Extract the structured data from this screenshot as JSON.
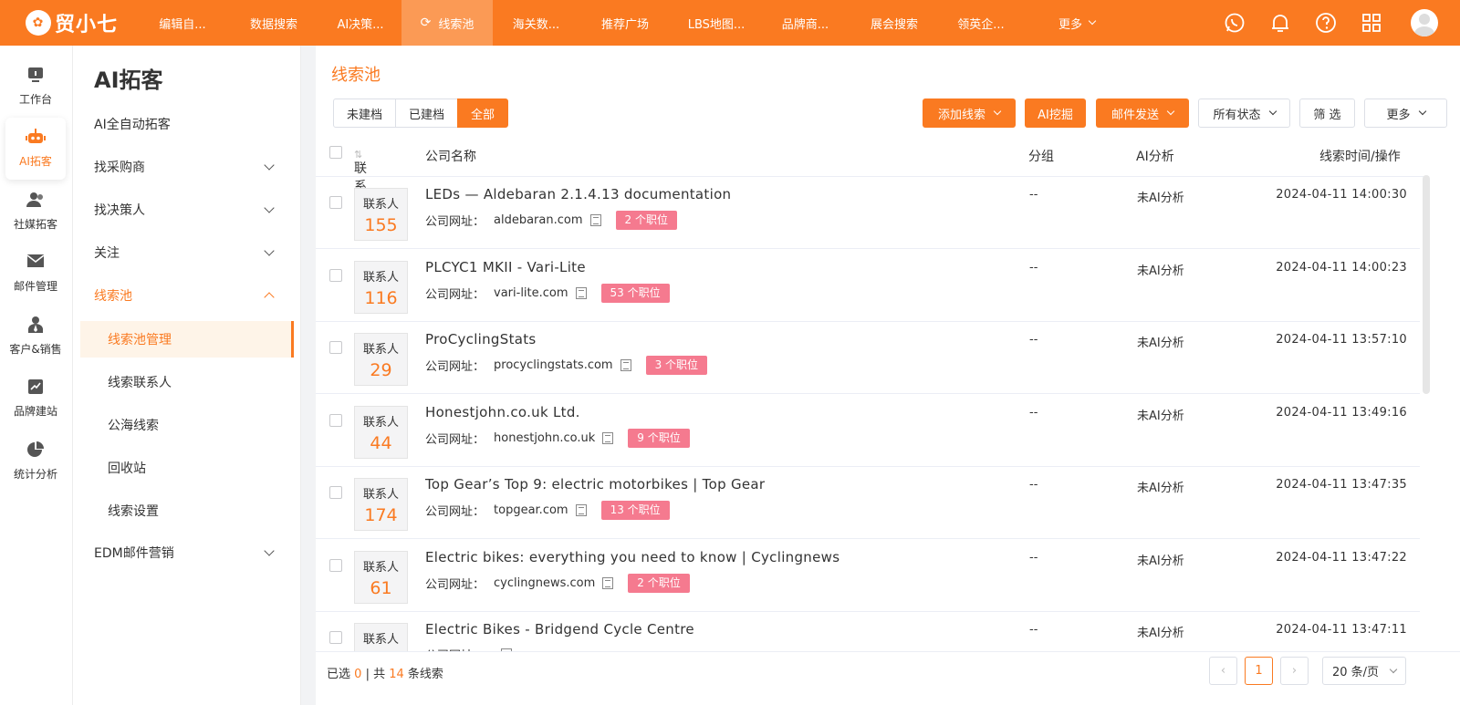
{
  "brand": {
    "name": "贸小七",
    "accent": "#fa7a21"
  },
  "topnav": [
    {
      "label": "编辑自...",
      "w": 100
    },
    {
      "label": "数据搜索",
      "w": 100
    },
    {
      "label": "AI决策...",
      "w": 90
    },
    {
      "label": "线索池",
      "w": 100,
      "active": true
    },
    {
      "label": "海关数...",
      "w": 95
    },
    {
      "label": "推荐广场",
      "w": 100
    },
    {
      "label": "LBS地图...",
      "w": 100
    },
    {
      "label": "品牌商...",
      "w": 95
    },
    {
      "label": "展会搜索",
      "w": 100
    },
    {
      "label": "领英企...",
      "w": 90
    },
    {
      "label": "更多",
      "w": 120,
      "dropdown": true
    }
  ],
  "rail": [
    {
      "label": "工作台",
      "icon": "monitor-icon"
    },
    {
      "label": "AI拓客",
      "icon": "robot-icon",
      "active": true
    },
    {
      "label": "社媒拓客",
      "icon": "users-icon"
    },
    {
      "label": "邮件管理",
      "icon": "mail-icon"
    },
    {
      "label": "客户&销售",
      "icon": "person-icon"
    },
    {
      "label": "品牌建站",
      "icon": "trend-icon"
    },
    {
      "label": "统计分析",
      "icon": "pie-icon"
    }
  ],
  "submenu": {
    "title": "AI拓客",
    "items": [
      {
        "label": "AI全自动拓客",
        "arrow": false
      },
      {
        "label": "找采购商",
        "arrow": true
      },
      {
        "label": "找决策人",
        "arrow": true
      },
      {
        "label": "关注",
        "arrow": true
      },
      {
        "label": "线索池",
        "arrow": true,
        "open": true
      }
    ],
    "children": [
      {
        "label": "线索池管理",
        "active": true
      },
      {
        "label": "线索联系人"
      },
      {
        "label": "公海线索"
      },
      {
        "label": "回收站"
      },
      {
        "label": "线索设置"
      }
    ],
    "last": {
      "label": "EDM邮件营销"
    }
  },
  "page": {
    "title": "线索池",
    "tabs": [
      "未建档",
      "已建档",
      "全部"
    ],
    "active_tab": "全部",
    "toolbar": {
      "add": "添加线索",
      "ai_mine": "AI挖掘",
      "mail": "邮件发送",
      "status": "所有状态",
      "filter": "筛 选",
      "more": "更多"
    },
    "columns": {
      "contact": "联系人",
      "company": "公司名称",
      "group": "分组",
      "ai": "AI分析",
      "time": "线索时间/操作"
    },
    "site_label": "公司网址：",
    "contact_label": "联系人",
    "rows": [
      {
        "contacts": "155",
        "name": "LEDs — Aldebaran 2.1.4.13 documentation",
        "site": "aldebaran.com",
        "jobs": "2 个职位",
        "group": "--",
        "ai": "未AI分析",
        "time": "2024-04-11 14:00:30"
      },
      {
        "contacts": "116",
        "name": "PLCYC1 MKII - Vari-Lite",
        "site": "vari-lite.com",
        "jobs": "53 个职位",
        "group": "--",
        "ai": "未AI分析",
        "time": "2024-04-11 14:00:23"
      },
      {
        "contacts": "29",
        "name": "ProCyclingStats",
        "site": "procyclingstats.com",
        "jobs": "3 个职位",
        "group": "--",
        "ai": "未AI分析",
        "time": "2024-04-11 13:57:10"
      },
      {
        "contacts": "44",
        "name": "Honestjohn.co.uk Ltd.",
        "site": "honestjohn.co.uk",
        "jobs": "9 个职位",
        "group": "--",
        "ai": "未AI分析",
        "time": "2024-04-11 13:49:16"
      },
      {
        "contacts": "174",
        "name": "Top Gear’s Top 9: electric motorbikes | Top Gear",
        "site": "topgear.com",
        "jobs": "13 个职位",
        "group": "--",
        "ai": "未AI分析",
        "time": "2024-04-11 13:47:35"
      },
      {
        "contacts": "61",
        "name": "Electric bikes: everything you need to know | Cyclingnews",
        "site": "cyclingnews.com",
        "jobs": "2 个职位",
        "group": "--",
        "ai": "未AI分析",
        "time": "2024-04-11 13:47:22"
      },
      {
        "contacts": "",
        "name": "Electric Bikes - Bridgend Cycle Centre",
        "site": "",
        "jobs": "",
        "group": "--",
        "ai": "未AI分析",
        "time": "2024-04-11 13:47:11"
      }
    ],
    "footer": {
      "selected_prefix": "已选",
      "selected": "0",
      "sep": "| 共",
      "total": "14",
      "suffix": "条线索",
      "page": "1",
      "page_size": "20 条/页"
    }
  }
}
